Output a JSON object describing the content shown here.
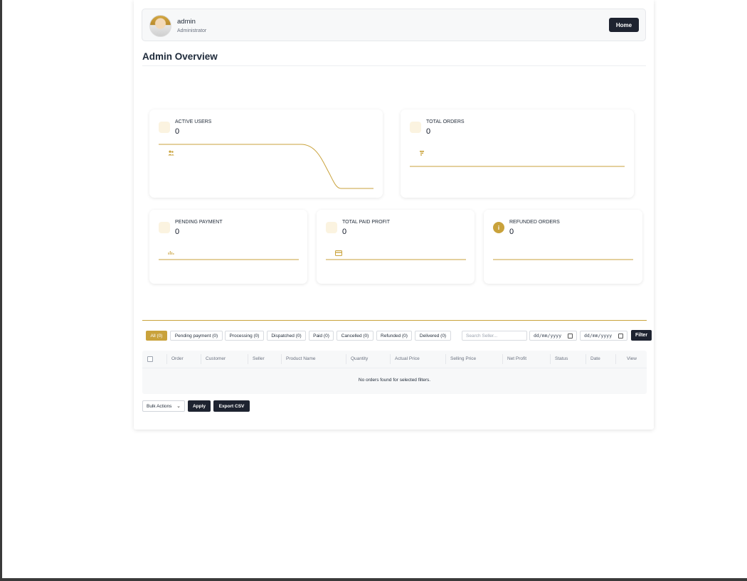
{
  "header": {
    "user_name": "admin",
    "user_role": "Administrator",
    "home_label": "Home"
  },
  "page": {
    "title": "Admin Overview"
  },
  "stats": {
    "active_users": {
      "label": "ACTIVE USERS",
      "value": "0"
    },
    "total_orders": {
      "label": "TOTAL ORDERS",
      "value": "0"
    },
    "pending_payment": {
      "label": "PENDING PAYMENT",
      "value": "0"
    },
    "total_paid_profit": {
      "label": "TOTAL PAID PROFIT",
      "value": "0"
    },
    "refunded_orders": {
      "label": "REFUNDED ORDERS",
      "value": "0"
    }
  },
  "filters": {
    "tabs": [
      "All (0)",
      "Pending payment (0)",
      "Processing (0)",
      "Dispatched (0)",
      "Paid (0)",
      "Cancelled (0)",
      "Refunded (0)",
      "Delivered (0)"
    ],
    "search_placeholder": "Search Seller...",
    "date_from": "dd/mm/yyyy",
    "date_to": "dd/mm/yyyy",
    "filter_label": "Filter"
  },
  "table": {
    "columns": [
      "Order",
      "Customer",
      "Seller",
      "Product Name",
      "Quantity",
      "Actual Price",
      "Selling Price",
      "Net Profit",
      "Status",
      "Date",
      "View"
    ],
    "empty_message": "No orders found for selected filters."
  },
  "actions": {
    "bulk_label": "Bulk Actions",
    "apply_label": "Apply",
    "export_label": "Export CSV"
  },
  "colors": {
    "accent": "#c9a23b",
    "dark": "#1e2330"
  }
}
